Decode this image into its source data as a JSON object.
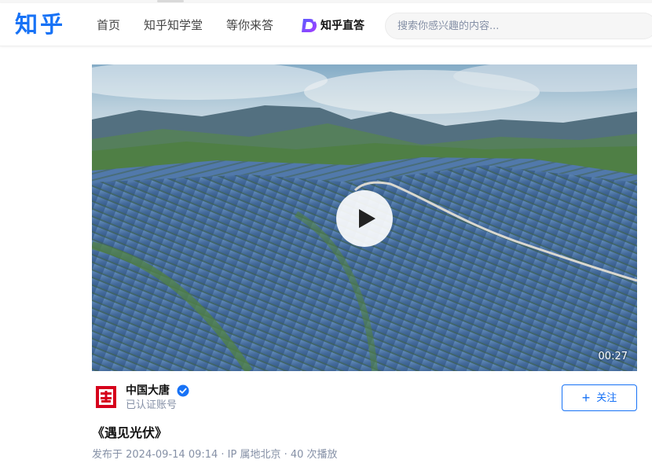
{
  "header": {
    "logo_text": "知乎",
    "nav": {
      "home": "首页",
      "school": "知乎知学堂",
      "waiting": "等你来答"
    },
    "zhida": {
      "label": "知乎直答",
      "icon": "zhida-d-icon"
    },
    "search": {
      "placeholder": "搜索你感兴趣的内容..."
    }
  },
  "video": {
    "thumbnail": "solar-farm-aerial",
    "duration": "00:27",
    "play_icon": "play-icon"
  },
  "author": {
    "name": "中国大唐",
    "subtitle": "已认证账号",
    "avatar_icon": "datang-logo",
    "verified_icon": "verified-badge-icon"
  },
  "follow": {
    "label": "关注",
    "icon": "plus-icon"
  },
  "post": {
    "title": "《遇见光伏》",
    "meta": "发布于 2024-09-14 09:14 · IP 属地北京 · 40 次播放"
  },
  "colors": {
    "brand": "#1772f6",
    "muted": "#8590a6",
    "avatar_red": "#d6001c",
    "zhida_purple": "#7a3cff"
  }
}
